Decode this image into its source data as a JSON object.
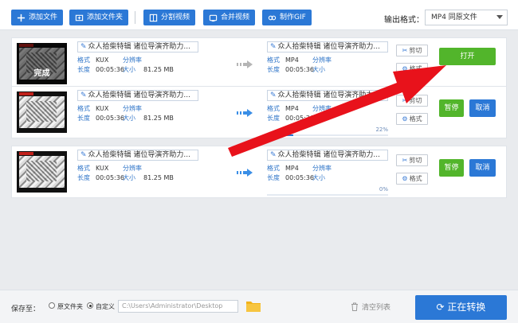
{
  "toolbar": {
    "add_file": "添加文件",
    "add_folder": "添加文件夹",
    "split_video": "分割视频",
    "merge_video": "合并视频",
    "make_gif": "制作GIF",
    "output_format_label": "输出格式：",
    "output_format_value": "MP4  同原文件"
  },
  "labels": {
    "format": "格式",
    "resolution": "分辨率",
    "duration": "长度",
    "size": "大小",
    "crop": "剪切",
    "format_btn": "格式"
  },
  "rows": [
    {
      "title": "众人拾柴特辑 诸位导演齐助力...",
      "src_format": "KUX",
      "src_duration": "00:05:36",
      "src_size": "81.25 MB",
      "dst_title": "众人拾柴特辑 诸位导演齐助力...",
      "dst_format": "MP4",
      "dst_duration": "00:05:36",
      "status_overlay": "完成",
      "action_primary": "打开",
      "progress": null
    },
    {
      "title": "众人拾柴特辑 诸位导演齐助力...",
      "src_format": "KUX",
      "src_duration": "00:05:36",
      "src_size": "81.25 MB",
      "dst_title": "众人拾柴特辑 诸位导演齐助力...",
      "dst_format": "MP4",
      "dst_duration": "00:05:36",
      "action_pause": "暂停",
      "action_cancel": "取消",
      "progress": 0.22,
      "progress_text": "22%"
    },
    {
      "title": "众人拾柴特辑 诸位导演齐助力...",
      "src_format": "KUX",
      "src_duration": "00:05:36",
      "src_size": "81.25 MB",
      "dst_title": "众人拾柴特辑 诸位导演齐助力...",
      "dst_format": "MP4",
      "dst_duration": "00:05:36",
      "action_pause": "暂停",
      "action_cancel": "取消",
      "progress": 0,
      "progress_text": "0%"
    }
  ],
  "bottom": {
    "save_to": "保存至：",
    "option_original": "原文件夹",
    "option_custom": "自定义",
    "path": "C:\\Users\\Administrator\\Desktop",
    "clear_list": "清空列表",
    "convert": "正在转换"
  },
  "colors": {
    "accent": "#2b78d6",
    "green": "#52b52b",
    "annotation_arrow": "#e8121b"
  }
}
